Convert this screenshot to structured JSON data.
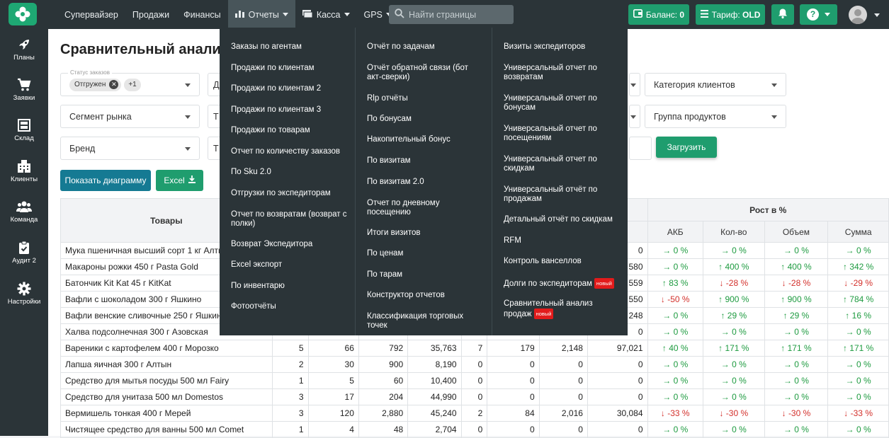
{
  "topnav": {
    "items": [
      "Супервайзер",
      "Продажи",
      "Финансы",
      "Отчеты",
      "Касса",
      "GPS"
    ],
    "search_placeholder": "Найти страницы",
    "balance_label": "Баланс:",
    "balance_value": "0",
    "tariff_label": "Тариф:",
    "tariff_value": "OLD",
    "help_label": "?"
  },
  "sidebar": [
    "Планы",
    "Заявки",
    "Склад",
    "Клиенты",
    "Команда",
    "Аудит 2",
    "Настройки"
  ],
  "page": {
    "title": "Сравнительный анализ продаж",
    "filters": {
      "status_label": "Статус заказов",
      "status_chip": "Отгружен",
      "status_more": "+1",
      "client_category": "Категория клиентов",
      "market_segment": "Сегмент рынка",
      "product_group": "Группа продуктов",
      "brand": "Бренд",
      "t1": "Т",
      "t2": "Д",
      "t3": "Т",
      "t4": "Т"
    },
    "load_button": "Загрузить",
    "diagram_button": "Показать диаграмму",
    "excel_button": "Excel"
  },
  "table": {
    "goods_header": "Товары",
    "growth_header": "Рост в %",
    "growth_cols": [
      "АКБ",
      "Кол-во",
      "Объем",
      "Сумма"
    ],
    "rows": [
      {
        "name": "Мука пшеничная высший сорт 1 кг Алты",
        "c1": "",
        "c2": "",
        "c3": "",
        "c4": "",
        "c5": "",
        "c6": "",
        "c7": "",
        "c8": "0",
        "g": [
          [
            "flat",
            "0 %"
          ],
          [
            "flat",
            "0 %"
          ],
          [
            "flat",
            "0 %"
          ],
          [
            "flat",
            "0 %"
          ]
        ]
      },
      {
        "name": "Макароны рожки 450 г Pasta Gold",
        "c1": "",
        "c2": "",
        "c3": "",
        "c4": "",
        "c5": "",
        "c6": "",
        "c7": "",
        "c8": "580",
        "g": [
          [
            "flat",
            "0 %"
          ],
          [
            "up",
            "400 %"
          ],
          [
            "up",
            "400 %"
          ],
          [
            "up",
            "342 %"
          ]
        ]
      },
      {
        "name": "Батончик Kit Kat 45 г KitKat",
        "c1": "",
        "c2": "",
        "c3": "",
        "c4": "",
        "c5": "",
        "c6": "",
        "c7": "",
        "c8": "559",
        "g": [
          [
            "up",
            "83 %"
          ],
          [
            "down",
            "-28 %"
          ],
          [
            "down",
            "-28 %"
          ],
          [
            "down",
            "-29 %"
          ]
        ]
      },
      {
        "name": "Вафли с шоколадом 300 г Яшкино",
        "c1": "",
        "c2": "",
        "c3": "",
        "c4": "",
        "c5": "",
        "c6": "",
        "c7": "",
        "c8": "550",
        "g": [
          [
            "down",
            "-50 %"
          ],
          [
            "up",
            "900 %"
          ],
          [
            "up",
            "900 %"
          ],
          [
            "up",
            "784 %"
          ]
        ]
      },
      {
        "name": "Вафли венские сливочные 250 г Яшкино",
        "c1": "",
        "c2": "",
        "c3": "",
        "c4": "",
        "c5": "",
        "c6": "",
        "c7": "",
        "c8": "248",
        "g": [
          [
            "flat",
            "0 %"
          ],
          [
            "up",
            "29 %"
          ],
          [
            "up",
            "29 %"
          ],
          [
            "up",
            "16 %"
          ]
        ]
      },
      {
        "name": "Халва подсолнечная 300 г Азовская",
        "c1": "",
        "c2": "",
        "c3": "",
        "c4": "",
        "c5": "",
        "c6": "",
        "c7": "",
        "c8": "0",
        "g": [
          [
            "flat",
            "0 %"
          ],
          [
            "flat",
            "0 %"
          ],
          [
            "flat",
            "0 %"
          ],
          [
            "flat",
            "0 %"
          ]
        ]
      },
      {
        "name": "Вареники с картофелем 400 г Морозко",
        "c1": "5",
        "c2": "66",
        "c3": "792",
        "c4": "35,763",
        "c5": "7",
        "c6": "179",
        "c7": "2,148",
        "c8": "97,021",
        "g": [
          [
            "up",
            "40 %"
          ],
          [
            "up",
            "171 %"
          ],
          [
            "up",
            "171 %"
          ],
          [
            "up",
            "171 %"
          ]
        ]
      },
      {
        "name": "Лапша яичная 300 г Алтын",
        "c1": "2",
        "c2": "30",
        "c3": "900",
        "c4": "8,190",
        "c5": "0",
        "c6": "0",
        "c7": "0",
        "c8": "0",
        "g": [
          [
            "flat",
            "0 %"
          ],
          [
            "flat",
            "0 %"
          ],
          [
            "flat",
            "0 %"
          ],
          [
            "flat",
            "0 %"
          ]
        ]
      },
      {
        "name": "Средство для мытья посуды 500 мл Fairy",
        "c1": "1",
        "c2": "5",
        "c3": "60",
        "c4": "10,400",
        "c5": "0",
        "c6": "0",
        "c7": "0",
        "c8": "0",
        "g": [
          [
            "flat",
            "0 %"
          ],
          [
            "flat",
            "0 %"
          ],
          [
            "flat",
            "0 %"
          ],
          [
            "flat",
            "0 %"
          ]
        ]
      },
      {
        "name": "Средство для унитаза 500 мл Domestos",
        "c1": "3",
        "c2": "17",
        "c3": "204",
        "c4": "44,990",
        "c5": "0",
        "c6": "0",
        "c7": "0",
        "c8": "0",
        "g": [
          [
            "flat",
            "0 %"
          ],
          [
            "flat",
            "0 %"
          ],
          [
            "flat",
            "0 %"
          ],
          [
            "flat",
            "0 %"
          ]
        ]
      },
      {
        "name": "Вермишель тонкая 400 г Мерей",
        "c1": "3",
        "c2": "120",
        "c3": "2,880",
        "c4": "45,240",
        "c5": "2",
        "c6": "84",
        "c7": "2,016",
        "c8": "30,084",
        "g": [
          [
            "down",
            "-33 %"
          ],
          [
            "down",
            "-30 %"
          ],
          [
            "down",
            "-30 %"
          ],
          [
            "down",
            "-33 %"
          ]
        ]
      },
      {
        "name": "Чистящее средство для ванны 500 мл Comet",
        "c1": "1",
        "c2": "4",
        "c3": "48",
        "c4": "2,704",
        "c5": "0",
        "c6": "0",
        "c7": "0",
        "c8": "0",
        "g": [
          [
            "flat",
            "0 %"
          ],
          [
            "flat",
            "0 %"
          ],
          [
            "flat",
            "0 %"
          ],
          [
            "flat",
            "0 %"
          ]
        ]
      }
    ]
  },
  "dropdown": {
    "col1": [
      "Заказы по агентам",
      "Продажи по клиентам",
      "Продажи по клиентам 2",
      "Продажи по клиентам 3",
      "Продажи по товарам",
      "Отчет по количеству заказов",
      "По Sku 2.0",
      "Отгрузки по экспедиторам",
      "Отчет по возвратам (возврат с полки)",
      "Возврат Экспедитора",
      "Excel экспорт",
      "По инвентарю",
      "Фотоотчёты"
    ],
    "col2": [
      "Отчёт по задачам",
      "Отчёт обратной связи (бот акт-сверки)",
      "Rlp отчёты",
      "По бонусам",
      "Накопительный бонус",
      "По визитам",
      "По визитам 2.0",
      "Отчет по дневному посещению",
      "Итоги визитов",
      "По ценам",
      "По тарам",
      "Конструктор отчетов",
      "Классификация торговых точек"
    ],
    "col3": [
      "Визиты экспедиторов",
      "Универсальный отчет по возвратам",
      "Универсальный отчет по бонусам",
      "Универсальный отчет по посещениям",
      "Универсальный отчет по скидкам",
      "Универсальный отчёт по продажам",
      "Детальный отчёт по скидкам",
      "RFM",
      "Контроль ванселлов",
      "Долги по экспедиторам",
      "Сравнительный анализ продаж"
    ],
    "new_badge": "новый"
  }
}
